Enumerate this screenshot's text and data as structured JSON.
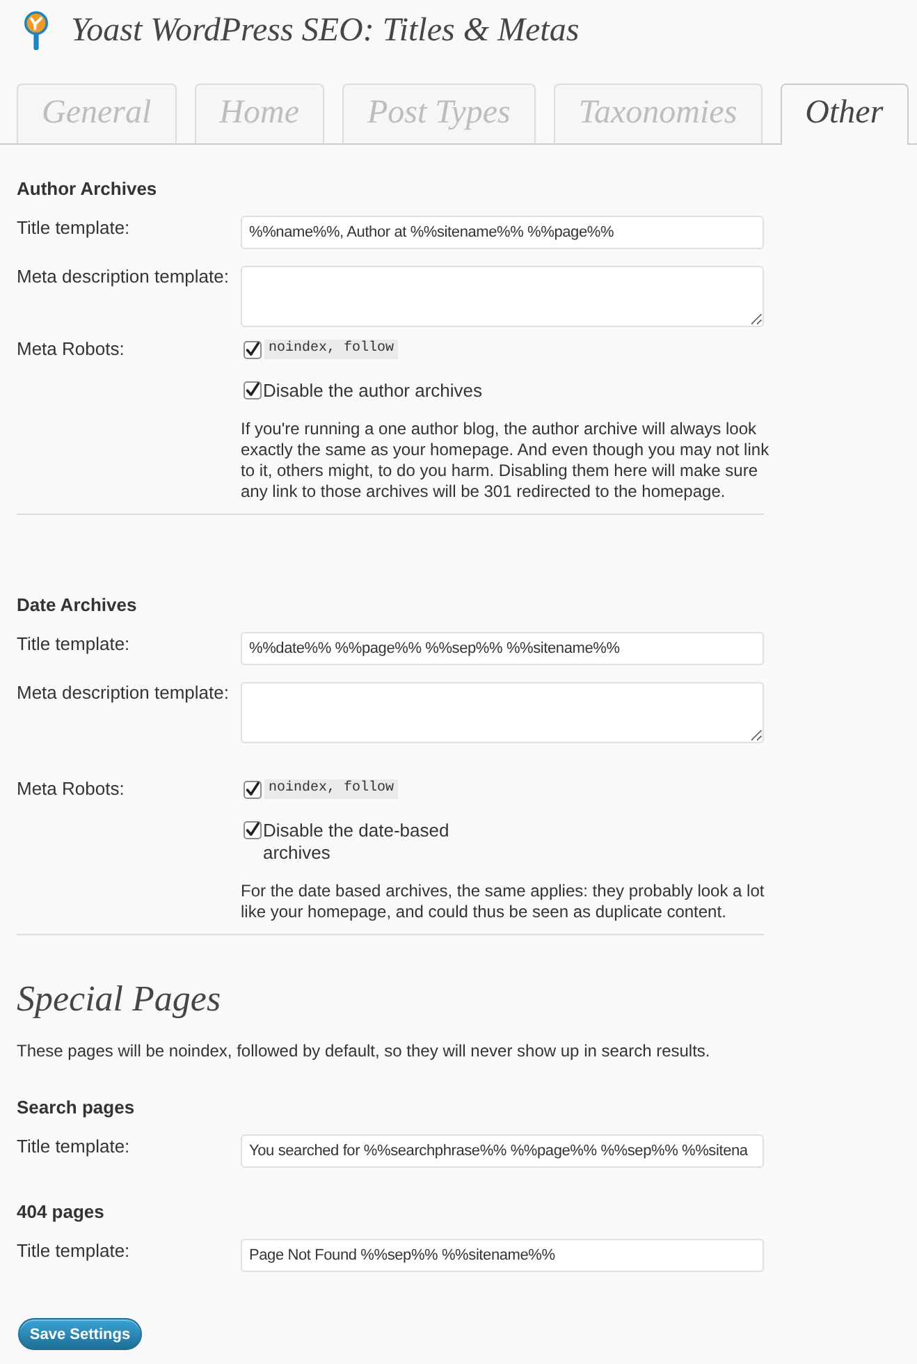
{
  "header": {
    "title": "Yoast WordPress SEO: Titles & Metas"
  },
  "tabs": [
    {
      "label": "General",
      "selected": false
    },
    {
      "label": "Home",
      "selected": false
    },
    {
      "label": "Post Types",
      "selected": false
    },
    {
      "label": "Taxonomies",
      "selected": false
    },
    {
      "label": "Other",
      "selected": true
    }
  ],
  "sections": [
    {
      "heading": "Author Archives",
      "rows": [
        {
          "kind": "input",
          "label": "Title template:",
          "value": "%%name%%, Author at %%sitename%% %%page%%"
        },
        {
          "kind": "textarea",
          "label": "Meta description template:"
        },
        {
          "kind": "robots",
          "label": "Meta Robots:",
          "option": "noindex, follow",
          "checked": true
        },
        {
          "kind": "checkbox",
          "option": "Disable the author archives",
          "checked": true
        },
        {
          "kind": "note",
          "text": "If you're running a one author blog, the author archive will always look exactly the same as your homepage. And even though you may not link to it, others might, to do you harm. Disabling them here will make sure any link to those archives will be 301 redirected to the homepage."
        }
      ]
    },
    {
      "heading": "Date Archives",
      "rows": [
        {
          "kind": "input",
          "label": "Title template:",
          "value": "%%date%% %%page%% %%sep%% %%sitename%%"
        },
        {
          "kind": "textarea",
          "label": "Meta description template:"
        },
        {
          "kind": "robots",
          "label": "Meta Robots:",
          "option": "noindex, follow",
          "checked": true
        },
        {
          "kind": "checkbox",
          "option": "Disable the date-based archives",
          "checked": true
        },
        {
          "kind": "note",
          "text": "For the date based archives, the same applies: they probably look a lot like your homepage, and could thus be seen as duplicate content."
        }
      ]
    }
  ],
  "special_pages": {
    "title": "Special Pages",
    "intro": "These pages will be noindex, followed by default, so they will never show up in search results.",
    "groups": [
      {
        "heading": "Search pages",
        "rows": [
          {
            "kind": "input",
            "label": "Title template:",
            "value": "You searched for %%searchphrase%% %%page%% %%sep%% %%sitena"
          }
        ]
      },
      {
        "heading": "404 pages",
        "rows": [
          {
            "kind": "input",
            "label": "Title template:",
            "value": "Page Not Found %%sep%% %%sitename%%"
          }
        ]
      }
    ]
  },
  "save_button": {
    "label": "Save Settings"
  }
}
